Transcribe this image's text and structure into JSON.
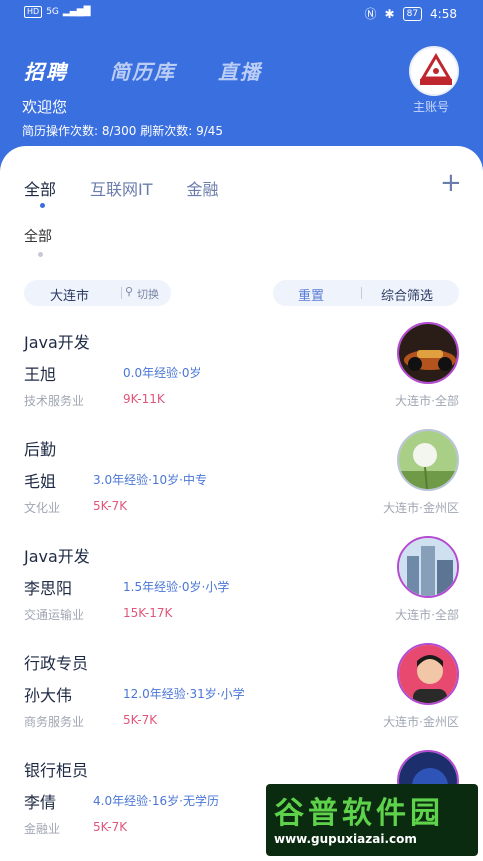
{
  "status_bar": {
    "network": "HD",
    "signal": "5G",
    "battery": "87",
    "time": "4:58"
  },
  "main_tabs": [
    "招聘",
    "简历库",
    "直播"
  ],
  "header": {
    "welcome": "欢迎您",
    "counts": "简历操作次数: 8/300  刷新次数: 9/45",
    "account_label": "主账号"
  },
  "category_tabs": [
    "全部",
    "互联网IT",
    "金融"
  ],
  "add_symbol": "+",
  "sub_category": "全部",
  "filters": {
    "city": "大连市",
    "switch_label": "切换",
    "reset_label": "重置",
    "filter_label": "综合筛选"
  },
  "candidates": [
    {
      "job": "Java开发",
      "name": "王旭",
      "experience": "0.0年经验·0岁",
      "industry": "技术服务业",
      "salary": "9K-11K",
      "location": "大连市·全部"
    },
    {
      "job": "后勤",
      "name": "毛姐",
      "experience": "3.0年经验·10岁·中专",
      "industry": "文化业",
      "salary": "5K-7K",
      "location": "大连市·金州区"
    },
    {
      "job": "Java开发",
      "name": "李思阳",
      "experience": "1.5年经验·0岁·小学",
      "industry": "交通运输业",
      "salary": "15K-17K",
      "location": "大连市·全部"
    },
    {
      "job": "行政专员",
      "name": "孙大伟",
      "experience": "12.0年经验·31岁·小学",
      "industry": "商务服务业",
      "salary": "5K-7K",
      "location": "大连市·金州区"
    },
    {
      "job": "银行柜员",
      "name": "李倩",
      "experience": "4.0年经验·16岁·无学历",
      "industry": "金融业",
      "salary": "5K-7K",
      "location": ""
    }
  ],
  "watermark": {
    "title": "谷普软件园",
    "url": "www.gupuxiazai.com"
  },
  "colors": {
    "primary": "#3a6fe0",
    "salary": "#e0567a",
    "experience": "#4a76d6"
  }
}
